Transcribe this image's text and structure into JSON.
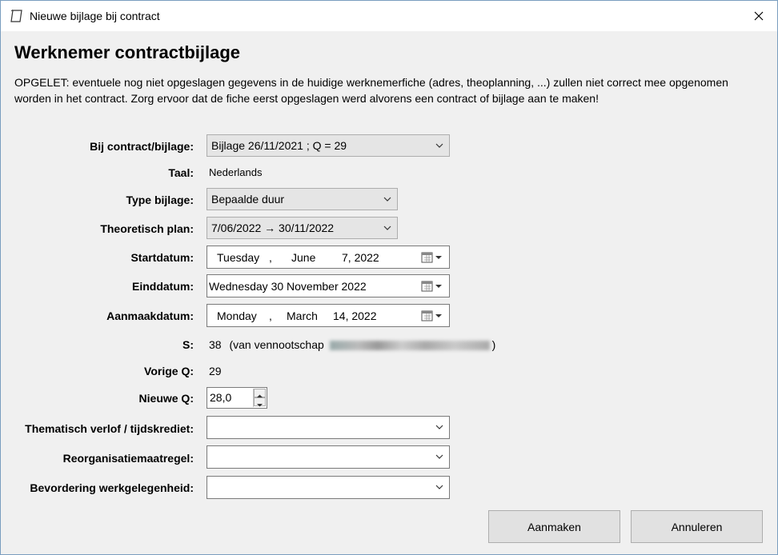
{
  "window": {
    "title": "Nieuwe bijlage bij contract",
    "icon": "document-icon"
  },
  "heading": "Werknemer contractbijlage",
  "warning": "OPGELET: eventuele nog niet opgeslagen gegevens in de huidige werknemerfiche (adres, theoplanning, ...) zullen niet correct mee opgenomen worden in het contract. Zorg ervoor dat de fiche eerst opgeslagen werd alvorens een contract of bijlage aan te maken!",
  "form": {
    "bij_contract": {
      "label": "Bij contract/bijlage:",
      "value": "Bijlage 26/11/2021 ; Q = 29"
    },
    "taal": {
      "label": "Taal:",
      "value": "Nederlands"
    },
    "type_bijlage": {
      "label": "Type bijlage:",
      "value": "Bepaalde duur"
    },
    "theoretisch_plan": {
      "label": "Theoretisch plan:",
      "value": "7/06/2022 → 30/11/2022"
    },
    "startdatum": {
      "label": "Startdatum:",
      "day": "Tuesday",
      "comma": ",",
      "month": "June",
      "date": "7, 2022"
    },
    "einddatum": {
      "label": "Einddatum:",
      "value": "Wednesday 30 November 2022"
    },
    "aanmaakdatum": {
      "label": "Aanmaakdatum:",
      "day": "Monday",
      "comma": ",",
      "month": "March",
      "date": "14, 2022"
    },
    "s": {
      "label": "S:",
      "value": "38",
      "prefix": "(van vennootschap",
      "suffix": ")"
    },
    "vorige_q": {
      "label": "Vorige Q:",
      "value": "29"
    },
    "nieuwe_q": {
      "label": "Nieuwe Q:",
      "value": "28,0"
    },
    "thematisch_verlof": {
      "label": "Thematisch verlof / tijdskrediet:",
      "value": ""
    },
    "reorganisatie": {
      "label": "Reorganisatiemaatregel:",
      "value": ""
    },
    "bevordering": {
      "label": "Bevordering werkgelegenheid:",
      "value": ""
    }
  },
  "buttons": {
    "create": "Aanmaken",
    "cancel": "Annuleren"
  },
  "colors": {
    "window_border": "#7a9dbf",
    "background": "#f0f0f0",
    "disabled_combo": "#e5e5e5"
  }
}
